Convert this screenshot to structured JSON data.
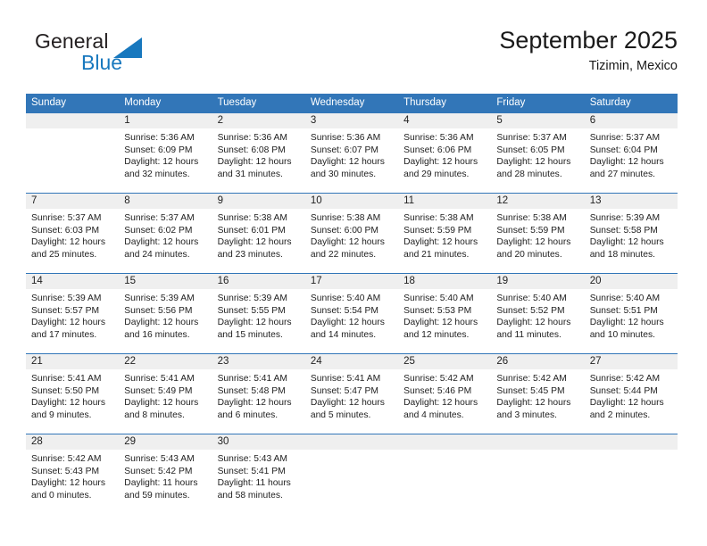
{
  "brand": {
    "name_top": "General",
    "name_bottom": "Blue",
    "mark": "triangle-logo",
    "color_primary": "#1878be",
    "color_text": "#231f20"
  },
  "header": {
    "title": "September 2025",
    "location": "Tizimin, Mexico"
  },
  "theme": {
    "header_bg": "#3276b8",
    "daynum_bg": "#efefef",
    "row_rule": "#3276b8"
  },
  "weekdays": [
    "Sunday",
    "Monday",
    "Tuesday",
    "Wednesday",
    "Thursday",
    "Friday",
    "Saturday"
  ],
  "weeks": [
    [
      {
        "day": ""
      },
      {
        "day": "1",
        "sunrise": "Sunrise: 5:36 AM",
        "sunset": "Sunset: 6:09 PM",
        "daylight_1": "Daylight: 12 hours",
        "daylight_2": "and 32 minutes."
      },
      {
        "day": "2",
        "sunrise": "Sunrise: 5:36 AM",
        "sunset": "Sunset: 6:08 PM",
        "daylight_1": "Daylight: 12 hours",
        "daylight_2": "and 31 minutes."
      },
      {
        "day": "3",
        "sunrise": "Sunrise: 5:36 AM",
        "sunset": "Sunset: 6:07 PM",
        "daylight_1": "Daylight: 12 hours",
        "daylight_2": "and 30 minutes."
      },
      {
        "day": "4",
        "sunrise": "Sunrise: 5:36 AM",
        "sunset": "Sunset: 6:06 PM",
        "daylight_1": "Daylight: 12 hours",
        "daylight_2": "and 29 minutes."
      },
      {
        "day": "5",
        "sunrise": "Sunrise: 5:37 AM",
        "sunset": "Sunset: 6:05 PM",
        "daylight_1": "Daylight: 12 hours",
        "daylight_2": "and 28 minutes."
      },
      {
        "day": "6",
        "sunrise": "Sunrise: 5:37 AM",
        "sunset": "Sunset: 6:04 PM",
        "daylight_1": "Daylight: 12 hours",
        "daylight_2": "and 27 minutes."
      }
    ],
    [
      {
        "day": "7",
        "sunrise": "Sunrise: 5:37 AM",
        "sunset": "Sunset: 6:03 PM",
        "daylight_1": "Daylight: 12 hours",
        "daylight_2": "and 25 minutes."
      },
      {
        "day": "8",
        "sunrise": "Sunrise: 5:37 AM",
        "sunset": "Sunset: 6:02 PM",
        "daylight_1": "Daylight: 12 hours",
        "daylight_2": "and 24 minutes."
      },
      {
        "day": "9",
        "sunrise": "Sunrise: 5:38 AM",
        "sunset": "Sunset: 6:01 PM",
        "daylight_1": "Daylight: 12 hours",
        "daylight_2": "and 23 minutes."
      },
      {
        "day": "10",
        "sunrise": "Sunrise: 5:38 AM",
        "sunset": "Sunset: 6:00 PM",
        "daylight_1": "Daylight: 12 hours",
        "daylight_2": "and 22 minutes."
      },
      {
        "day": "11",
        "sunrise": "Sunrise: 5:38 AM",
        "sunset": "Sunset: 5:59 PM",
        "daylight_1": "Daylight: 12 hours",
        "daylight_2": "and 21 minutes."
      },
      {
        "day": "12",
        "sunrise": "Sunrise: 5:38 AM",
        "sunset": "Sunset: 5:59 PM",
        "daylight_1": "Daylight: 12 hours",
        "daylight_2": "and 20 minutes."
      },
      {
        "day": "13",
        "sunrise": "Sunrise: 5:39 AM",
        "sunset": "Sunset: 5:58 PM",
        "daylight_1": "Daylight: 12 hours",
        "daylight_2": "and 18 minutes."
      }
    ],
    [
      {
        "day": "14",
        "sunrise": "Sunrise: 5:39 AM",
        "sunset": "Sunset: 5:57 PM",
        "daylight_1": "Daylight: 12 hours",
        "daylight_2": "and 17 minutes."
      },
      {
        "day": "15",
        "sunrise": "Sunrise: 5:39 AM",
        "sunset": "Sunset: 5:56 PM",
        "daylight_1": "Daylight: 12 hours",
        "daylight_2": "and 16 minutes."
      },
      {
        "day": "16",
        "sunrise": "Sunrise: 5:39 AM",
        "sunset": "Sunset: 5:55 PM",
        "daylight_1": "Daylight: 12 hours",
        "daylight_2": "and 15 minutes."
      },
      {
        "day": "17",
        "sunrise": "Sunrise: 5:40 AM",
        "sunset": "Sunset: 5:54 PM",
        "daylight_1": "Daylight: 12 hours",
        "daylight_2": "and 14 minutes."
      },
      {
        "day": "18",
        "sunrise": "Sunrise: 5:40 AM",
        "sunset": "Sunset: 5:53 PM",
        "daylight_1": "Daylight: 12 hours",
        "daylight_2": "and 12 minutes."
      },
      {
        "day": "19",
        "sunrise": "Sunrise: 5:40 AM",
        "sunset": "Sunset: 5:52 PM",
        "daylight_1": "Daylight: 12 hours",
        "daylight_2": "and 11 minutes."
      },
      {
        "day": "20",
        "sunrise": "Sunrise: 5:40 AM",
        "sunset": "Sunset: 5:51 PM",
        "daylight_1": "Daylight: 12 hours",
        "daylight_2": "and 10 minutes."
      }
    ],
    [
      {
        "day": "21",
        "sunrise": "Sunrise: 5:41 AM",
        "sunset": "Sunset: 5:50 PM",
        "daylight_1": "Daylight: 12 hours",
        "daylight_2": "and 9 minutes."
      },
      {
        "day": "22",
        "sunrise": "Sunrise: 5:41 AM",
        "sunset": "Sunset: 5:49 PM",
        "daylight_1": "Daylight: 12 hours",
        "daylight_2": "and 8 minutes."
      },
      {
        "day": "23",
        "sunrise": "Sunrise: 5:41 AM",
        "sunset": "Sunset: 5:48 PM",
        "daylight_1": "Daylight: 12 hours",
        "daylight_2": "and 6 minutes."
      },
      {
        "day": "24",
        "sunrise": "Sunrise: 5:41 AM",
        "sunset": "Sunset: 5:47 PM",
        "daylight_1": "Daylight: 12 hours",
        "daylight_2": "and 5 minutes."
      },
      {
        "day": "25",
        "sunrise": "Sunrise: 5:42 AM",
        "sunset": "Sunset: 5:46 PM",
        "daylight_1": "Daylight: 12 hours",
        "daylight_2": "and 4 minutes."
      },
      {
        "day": "26",
        "sunrise": "Sunrise: 5:42 AM",
        "sunset": "Sunset: 5:45 PM",
        "daylight_1": "Daylight: 12 hours",
        "daylight_2": "and 3 minutes."
      },
      {
        "day": "27",
        "sunrise": "Sunrise: 5:42 AM",
        "sunset": "Sunset: 5:44 PM",
        "daylight_1": "Daylight: 12 hours",
        "daylight_2": "and 2 minutes."
      }
    ],
    [
      {
        "day": "28",
        "sunrise": "Sunrise: 5:42 AM",
        "sunset": "Sunset: 5:43 PM",
        "daylight_1": "Daylight: 12 hours",
        "daylight_2": "and 0 minutes."
      },
      {
        "day": "29",
        "sunrise": "Sunrise: 5:43 AM",
        "sunset": "Sunset: 5:42 PM",
        "daylight_1": "Daylight: 11 hours",
        "daylight_2": "and 59 minutes."
      },
      {
        "day": "30",
        "sunrise": "Sunrise: 5:43 AM",
        "sunset": "Sunset: 5:41 PM",
        "daylight_1": "Daylight: 11 hours",
        "daylight_2": "and 58 minutes."
      },
      {
        "day": ""
      },
      {
        "day": ""
      },
      {
        "day": ""
      },
      {
        "day": ""
      }
    ]
  ]
}
